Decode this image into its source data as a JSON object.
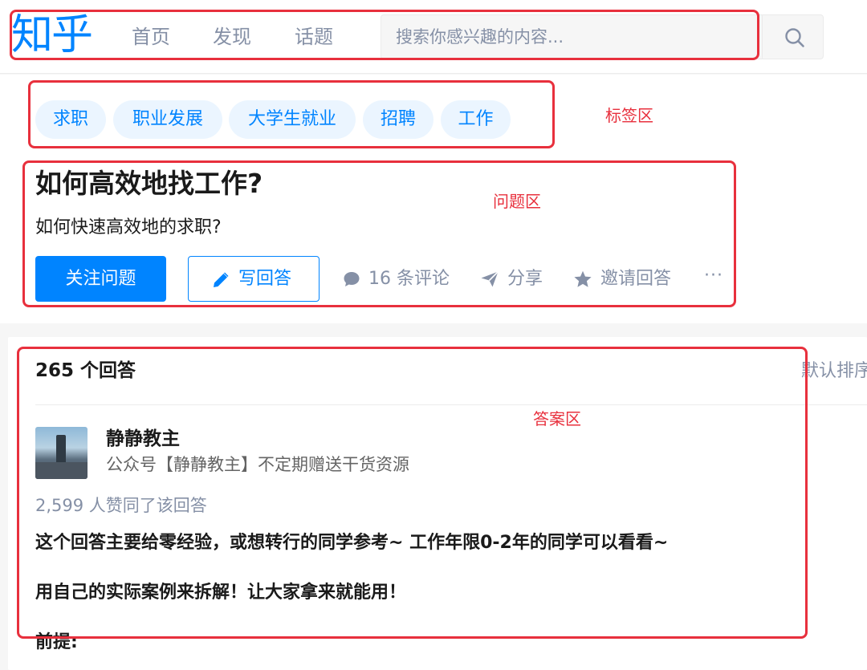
{
  "header": {
    "logo": "知乎",
    "nav": [
      "首页",
      "发现",
      "话题"
    ],
    "search_placeholder": "搜索你感兴趣的内容..."
  },
  "question": {
    "tags": [
      "求职",
      "职业发展",
      "大学生就业",
      "招聘",
      "工作"
    ],
    "title": "如何高效地找工作?",
    "detail": "如何快速高效地的求职?",
    "follow_label": "关注问题",
    "write_answer_label": "写回答",
    "comments_label": "16 条评论",
    "share_label": "分享",
    "invite_label": "邀请回答",
    "more_label": "···"
  },
  "answers": {
    "count_label": "265 个回答",
    "sort_label": "默认排序",
    "author_name": "静静教主",
    "author_bio": "公众号【静静教主】不定期赠送干货资源",
    "votes_label": "2,599 人赞同了该回答",
    "paragraphs": [
      "这个回答主要给零经验，或想转行的同学参考~ 工作年限0-2年的同学可以看看~",
      "用自己的实际案例来拆解！让大家拿来就能用！",
      "前提:"
    ]
  },
  "annotations": {
    "tag_area": "标签区",
    "question_area": "问题区",
    "answer_area": "答案区"
  },
  "colors": {
    "brand": "#0084ff",
    "annotation": "#e8303d",
    "muted": "#8590a6"
  },
  "icons": [
    "search-icon",
    "pencil-icon",
    "comment-icon",
    "share-icon",
    "star-icon",
    "more-icon"
  ]
}
